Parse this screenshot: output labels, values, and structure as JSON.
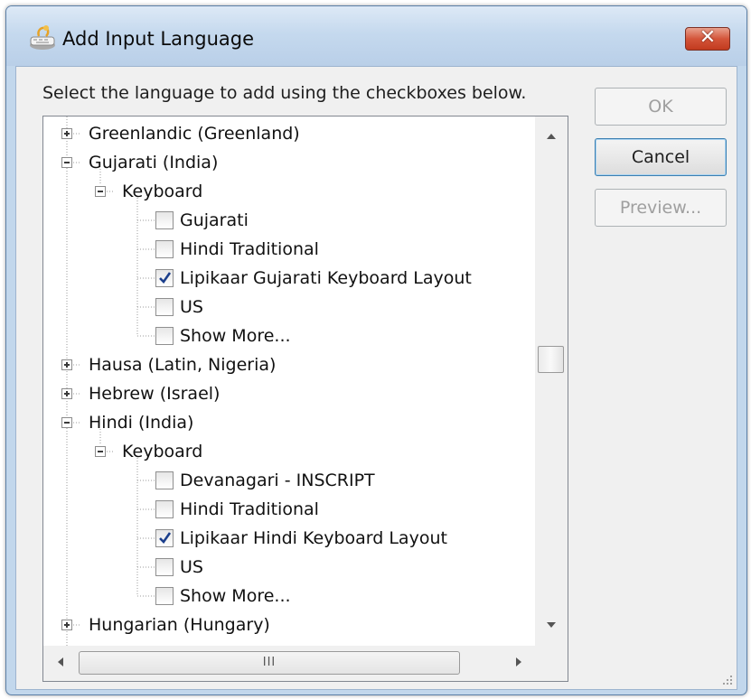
{
  "window": {
    "title": "Add Input Language",
    "close_label": "✕"
  },
  "dialog": {
    "instruction": "Select the language to add using the checkboxes below.",
    "ok_label": "OK",
    "cancel_label": "Cancel",
    "preview_label": "Preview..."
  },
  "tree": {
    "rows": [
      {
        "label": "Greenlandic (Greenland)",
        "kind": "language",
        "expanded": false
      },
      {
        "label": "Gujarati (India)",
        "kind": "language",
        "expanded": true
      },
      {
        "label": "Keyboard",
        "kind": "group",
        "expanded": true
      },
      {
        "label": "Gujarati",
        "kind": "layout",
        "checked": false
      },
      {
        "label": "Hindi Traditional",
        "kind": "layout",
        "checked": false
      },
      {
        "label": "Lipikaar Gujarati Keyboard Layout",
        "kind": "layout",
        "checked": true
      },
      {
        "label": "US",
        "kind": "layout",
        "checked": false
      },
      {
        "label": "Show More...",
        "kind": "layout",
        "checked": false
      },
      {
        "label": "Hausa (Latin, Nigeria)",
        "kind": "language",
        "expanded": false
      },
      {
        "label": "Hebrew (Israel)",
        "kind": "language",
        "expanded": false
      },
      {
        "label": "Hindi (India)",
        "kind": "language",
        "expanded": true
      },
      {
        "label": "Keyboard",
        "kind": "group",
        "expanded": true
      },
      {
        "label": "Devanagari - INSCRIPT",
        "kind": "layout",
        "checked": false
      },
      {
        "label": "Hindi Traditional",
        "kind": "layout",
        "checked": false
      },
      {
        "label": "Lipikaar Hindi Keyboard Layout",
        "kind": "layout",
        "checked": true
      },
      {
        "label": "US",
        "kind": "layout",
        "checked": false
      },
      {
        "label": "Show More...",
        "kind": "layout",
        "checked": false
      },
      {
        "label": "Hungarian (Hungary)",
        "kind": "language",
        "expanded": false
      }
    ]
  },
  "scrollbar": {
    "vertical_position": 0.45,
    "horizontal_grip": "III"
  },
  "colors": {
    "title_bar": "#c5d9ee",
    "close_button": "#d4553a",
    "checkmark": "#1c3f8c",
    "tree_lines": "#9b9b9b"
  }
}
